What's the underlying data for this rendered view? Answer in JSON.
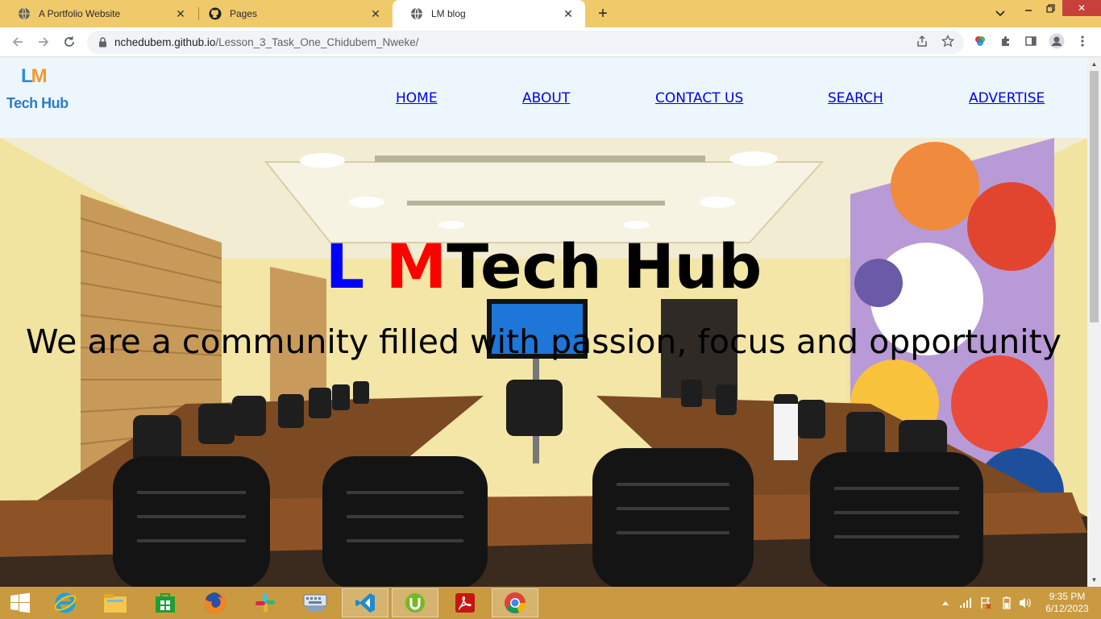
{
  "browser": {
    "tabs": [
      {
        "title": "A Portfolio Website",
        "icon": "globe-icon",
        "active": false
      },
      {
        "title": "Pages",
        "icon": "github-icon",
        "active": false
      },
      {
        "title": "LM blog",
        "icon": "globe-icon",
        "active": true
      }
    ],
    "url_host": "nchedubem.github.io",
    "url_path": "/Lesson_3_Task_One_Chidubem_Nweke/"
  },
  "site": {
    "logo": {
      "mark_l": "L",
      "mark_m": "M",
      "text": "Tech Hub"
    },
    "nav": [
      {
        "label": "HOME"
      },
      {
        "label": "ABOUT"
      },
      {
        "label": "CONTACT US"
      },
      {
        "label": "SEARCH"
      },
      {
        "label": "ADVERTISE"
      }
    ],
    "hero": {
      "title_l": "L",
      "title_m": "M",
      "title_rest": "Tech Hub",
      "subtitle": "We are a community filled with passion, focus and opportunity"
    }
  },
  "taskbar": {
    "apps": [
      "start-icon",
      "internet-explorer-icon",
      "file-explorer-icon",
      "store-icon",
      "firefox-icon",
      "slack-icon",
      "keyboard-icon",
      "vscode-icon",
      "utorrent-icon",
      "acrobat-icon",
      "chrome-icon"
    ],
    "time": "9:35 PM",
    "date": "6/12/2023"
  },
  "colors": {
    "tab_strip": "#f0c96b",
    "taskbar": "#c99a3f",
    "header_bg": "#eef6fd",
    "link": "#0000ee",
    "title_l": "#0000ff",
    "title_m": "#ff0000"
  }
}
